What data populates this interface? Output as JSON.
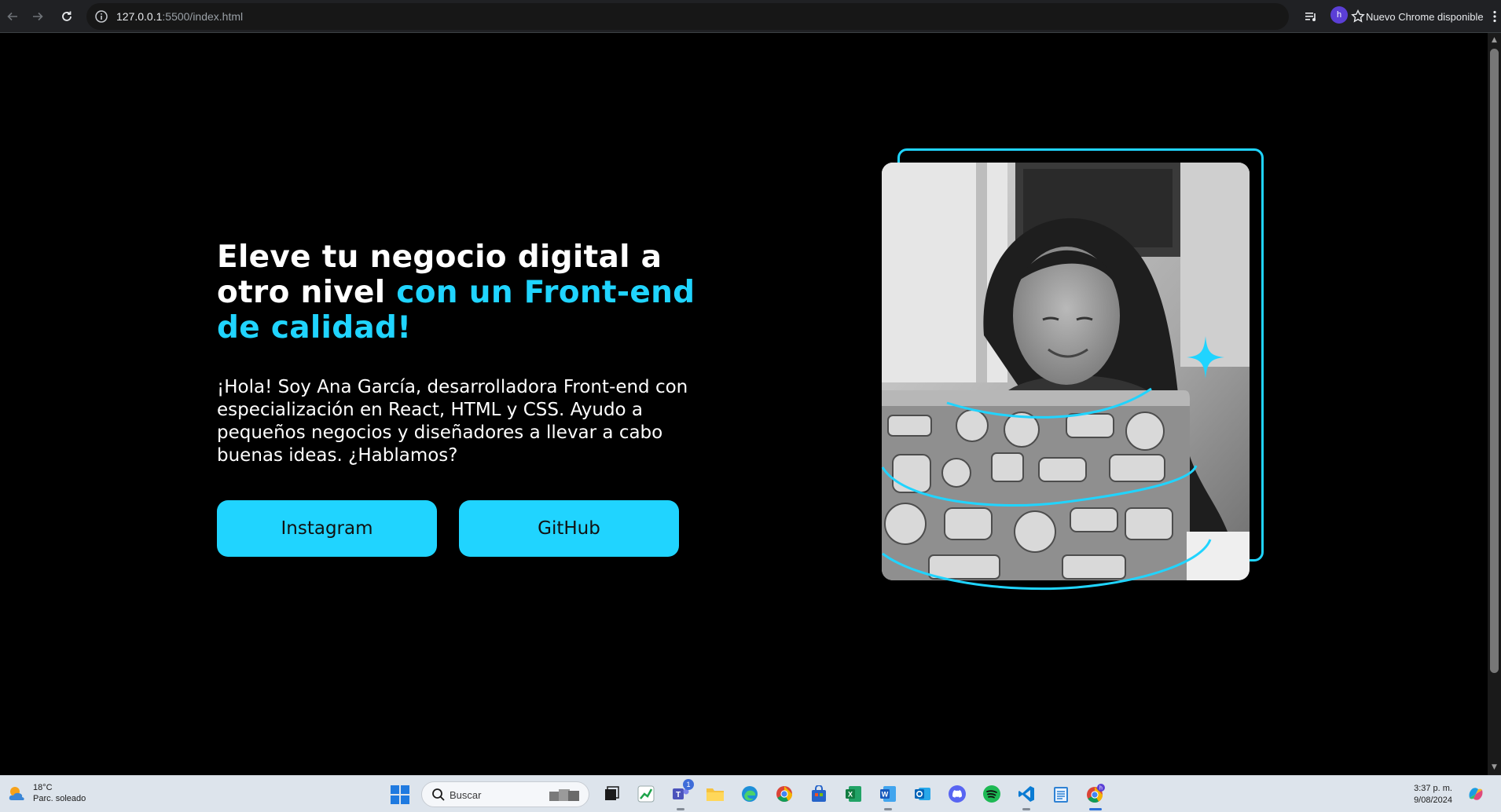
{
  "browser": {
    "url_host": "127.0.0.1",
    "url_rest": ":5500/index.html",
    "profile_initial": "h",
    "update_label": "Nuevo Chrome disponible"
  },
  "hero": {
    "title_plain": "Eleve tu negocio digital a otro nivel ",
    "title_accent": "con un Front-end de calidad!",
    "paragraph": "¡Hola! Soy Ana García, desarrolladora Front-end con especialización en React, HTML y CSS. Ayudo a pequeños negocios y diseñadores a llevar a cabo buenas ideas. ¿Hablamos?",
    "buttons": {
      "instagram": "Instagram",
      "github": "GitHub"
    },
    "accent_color": "#20d4ff"
  },
  "taskbar": {
    "weather_temp": "18°C",
    "weather_desc": "Parc. soleado",
    "search_placeholder": "Buscar",
    "teams_badge": "1",
    "time": "3:37 p. m.",
    "date": "9/08/2024",
    "apps": [
      "file-explorer",
      "stock-app",
      "teams",
      "folder",
      "edge",
      "chrome",
      "store",
      "excel",
      "word",
      "outlook",
      "discord",
      "spotify",
      "vscode",
      "notepad",
      "chrome-profile"
    ]
  }
}
